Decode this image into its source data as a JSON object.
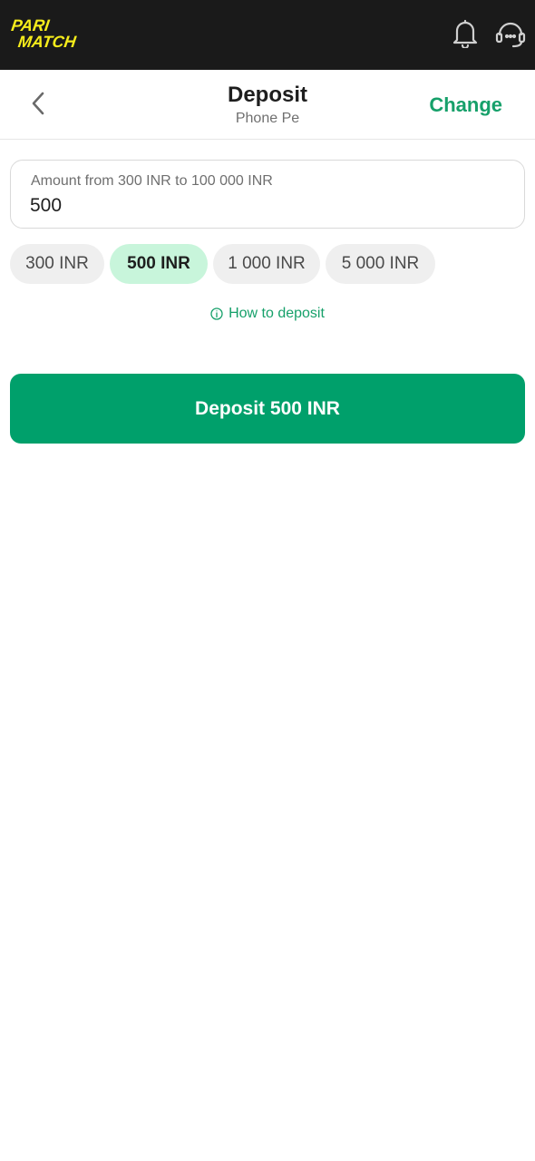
{
  "brand": {
    "logo_line1": "PARI",
    "logo_line2": "MATCH",
    "logo_color": "#f5ec1b",
    "topbar_bg": "#1a1a1a"
  },
  "topbar": {
    "icons": [
      "bell-icon",
      "support-headset-icon"
    ]
  },
  "header": {
    "back_icon": "chevron-left-icon",
    "title": "Deposit",
    "subtitle": "Phone Pe",
    "change_label": "Change"
  },
  "amount": {
    "label": "Amount from 300 INR to 100 000 INR",
    "value": "500"
  },
  "presets": [
    {
      "label": "300 INR",
      "selected": false
    },
    {
      "label": "500 INR",
      "selected": true
    },
    {
      "label": "1 000 INR",
      "selected": false
    },
    {
      "label": "5 000 INR",
      "selected": false
    }
  ],
  "help": {
    "icon": "info-icon",
    "label": "How to deposit"
  },
  "submit": {
    "label": "Deposit 500 INR"
  },
  "colors": {
    "accent": "#00a06b",
    "link": "#16a06a",
    "chip_selected_bg": "#c8f5db",
    "chip_bg": "#efefef"
  }
}
